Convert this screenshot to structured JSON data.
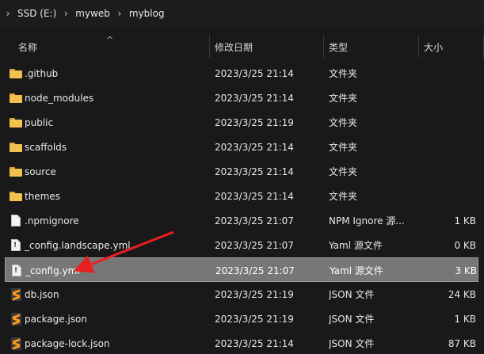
{
  "breadcrumb": {
    "items": [
      "SSD (E:)",
      "myweb",
      "myblog"
    ]
  },
  "columns": {
    "name": "名称",
    "date": "修改日期",
    "type": "类型",
    "size": "大小"
  },
  "rows": [
    {
      "icon": "folder-icon",
      "name": ".github",
      "date": "2023/3/25 21:14",
      "type": "文件夹",
      "size": ""
    },
    {
      "icon": "folder-icon",
      "name": "node_modules",
      "date": "2023/3/25 21:14",
      "type": "文件夹",
      "size": ""
    },
    {
      "icon": "folder-icon",
      "name": "public",
      "date": "2023/3/25 21:19",
      "type": "文件夹",
      "size": ""
    },
    {
      "icon": "folder-icon",
      "name": "scaffolds",
      "date": "2023/3/25 21:14",
      "type": "文件夹",
      "size": ""
    },
    {
      "icon": "folder-icon",
      "name": "source",
      "date": "2023/3/25 21:14",
      "type": "文件夹",
      "size": ""
    },
    {
      "icon": "folder-icon",
      "name": "themes",
      "date": "2023/3/25 21:14",
      "type": "文件夹",
      "size": ""
    },
    {
      "icon": "file-icon",
      "name": ".npmignore",
      "date": "2023/3/25 21:07",
      "type": "NPM Ignore 源...",
      "size": "1 KB"
    },
    {
      "icon": "yaml-file-icon",
      "name": "_config.landscape.yml",
      "date": "2023/3/25 21:07",
      "type": "Yaml 源文件",
      "size": "0 KB"
    },
    {
      "icon": "yaml-file-icon",
      "name": "_config.yml",
      "date": "2023/3/25 21:07",
      "type": "Yaml 源文件",
      "size": "3 KB",
      "selected": true
    },
    {
      "icon": "sublime-file-icon",
      "name": "db.json",
      "date": "2023/3/25 21:19",
      "type": "JSON 文件",
      "size": "24 KB"
    },
    {
      "icon": "sublime-file-icon",
      "name": "package.json",
      "date": "2023/3/25 21:19",
      "type": "JSON 文件",
      "size": "1 KB"
    },
    {
      "icon": "sublime-file-icon",
      "name": "package-lock.json",
      "date": "2023/3/25 21:14",
      "type": "JSON 文件",
      "size": "87 KB"
    }
  ],
  "annotation": {
    "arrow_color": "#e8201f"
  },
  "colors": {
    "background": "#191919",
    "selection": "#777777",
    "folder": "#f2c14e"
  }
}
